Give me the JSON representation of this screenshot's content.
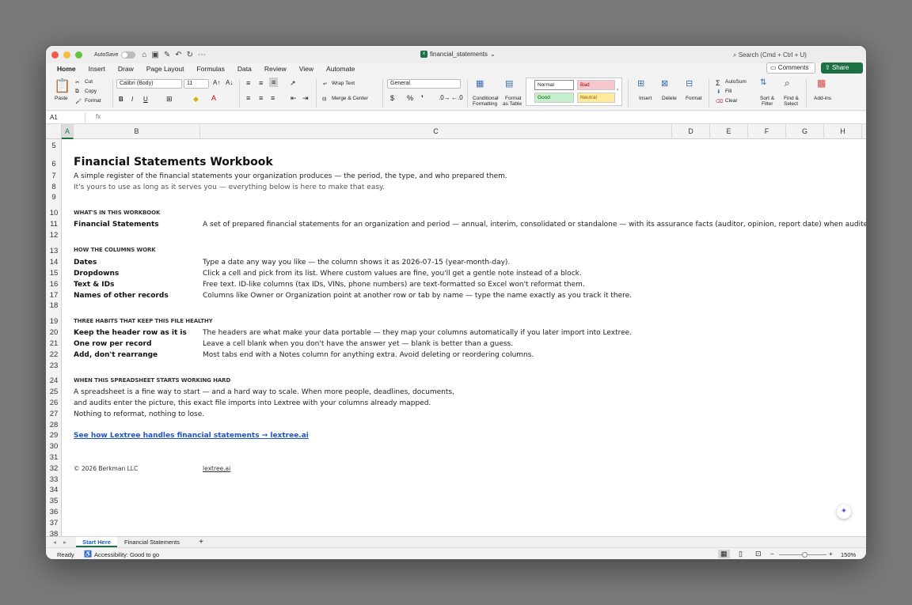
{
  "app": {
    "autosave_label": "AutoSave",
    "document_title": "financial_statements",
    "search_placeholder": "Search (Cmd + Ctrl + U)",
    "comments_label": "Comments",
    "share_label": "Share",
    "accent_color": "#1d7044"
  },
  "menu_tabs": [
    "Home",
    "Insert",
    "Draw",
    "Page Layout",
    "Formulas",
    "Data",
    "Review",
    "View",
    "Automate"
  ],
  "ribbon": {
    "paste": "Paste",
    "cut": "Cut",
    "copy": "Copy",
    "format_painter": "Format",
    "font_name": "Calibri (Body)",
    "font_size": "11",
    "bold": "B",
    "italic": "I",
    "underline": "U",
    "wrap_text": "Wrap Text",
    "merge_center": "Merge & Center",
    "number_format": "General",
    "currency": "$",
    "percent": "%",
    "comma": "❜",
    "conditional_formatting_1": "Conditional",
    "conditional_formatting_2": "Formatting",
    "format_as_table_1": "Format",
    "format_as_table_2": "as Table",
    "style_normal": "Normal",
    "style_bad": "Bad",
    "style_good": "Good",
    "style_neutral": "Neutral",
    "insert": "Insert",
    "delete": "Delete",
    "format": "Format",
    "autosum": "AutoSum",
    "fill": "Fill",
    "clear": "Clear",
    "sort_filter_1": "Sort &",
    "sort_filter_2": "Filter",
    "find_select_1": "Find &",
    "find_select_2": "Select",
    "addins": "Add-ins"
  },
  "formula_bar": {
    "name_box": "A1",
    "fx": "fx",
    "value": ""
  },
  "columns": [
    "A",
    "B",
    "C",
    "D",
    "E",
    "F",
    "G",
    "H"
  ],
  "rows": [
    "5",
    "6",
    "7",
    "8",
    "9",
    "10",
    "11",
    "12",
    "13",
    "14",
    "15",
    "16",
    "17",
    "18",
    "19",
    "20",
    "21",
    "22",
    "23",
    "24",
    "25",
    "26",
    "27",
    "28",
    "29",
    "30",
    "31",
    "32",
    "33",
    "34",
    "35",
    "36",
    "37",
    "38"
  ],
  "sheet": {
    "title": "Financial Statements Workbook",
    "intro1": "A simple register of the financial statements your organization produces — the period, the type, and who prepared them.",
    "intro2": "It's yours to use as long as it serves you — everything below is here to make that easy.",
    "sec_whats_in": "WHAT'S IN THIS WORKBOOK",
    "fs_label": "Financial Statements",
    "fs_desc": "A set of prepared financial statements for an organization and period — annual, interim, consolidated or standalone — with its assurance facts (auditor, opinion, report date) when audited or reviewed.",
    "sec_columns": "HOW THE COLUMNS WORK",
    "dates_label": "Dates",
    "dates_desc": "Type a date any way you like — the column shows it as 2026-07-15 (year-month-day).",
    "dropdowns_label": "Dropdowns",
    "dropdowns_desc": "Click a cell and pick from its list. Where custom values are fine, you'll get a gentle note instead of a block.",
    "text_label": "Text & IDs",
    "text_desc": "Free text. ID-like columns (tax IDs, VINs, phone numbers) are text-formatted so Excel won't reformat them.",
    "names_label": "Names of other records",
    "names_desc": "Columns like Owner or Organization point at another row or tab by name — type the name exactly as you track it there.",
    "sec_habits": "THREE HABITS THAT KEEP THIS FILE HEALTHY",
    "habit1_label": "Keep the header row as it is",
    "habit1_desc": "The headers are what make your data portable — they map your columns automatically if you later import into Lextree.",
    "habit2_label": "One row per record",
    "habit2_desc": "Leave a cell blank when you don't have the answer yet — blank is better than a guess.",
    "habit3_label": "Add, don't rearrange",
    "habit3_desc": "Most tabs end with a Notes column for anything extra. Avoid deleting or reordering columns.",
    "sec_outgrow": "WHEN THIS SPREADSHEET STARTS WORKING HARD",
    "outgrow1": "A spreadsheet is a fine way to start — and a hard way to scale. When more people, deadlines, documents,",
    "outgrow2": "and audits enter the picture, this exact file imports into Lextree with your columns already mapped.",
    "outgrow3": "Nothing to reformat, nothing to lose.",
    "cta_link": "See how Lextree handles financial statements → lextree.ai",
    "copyright": "© 2026 Berkman LLC",
    "footer_link": "lextree.ai"
  },
  "sheet_tabs": [
    "Start Here",
    "Financial Statements"
  ],
  "add_sheet": "+",
  "status": {
    "ready": "Ready",
    "accessibility": "Accessibility: Good to go",
    "zoom": "150%"
  }
}
